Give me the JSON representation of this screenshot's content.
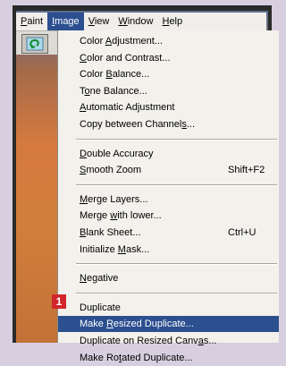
{
  "menubar": {
    "items": [
      {
        "label": "Paint",
        "u": 0
      },
      {
        "label": "Image",
        "u": 0
      },
      {
        "label": "View",
        "u": 0
      },
      {
        "label": "Window",
        "u": 0
      },
      {
        "label": "Help",
        "u": 0
      }
    ],
    "active_index": 1
  },
  "toolbar": {
    "icon": "rotate-arrow-icon"
  },
  "image_menu": {
    "groups": [
      [
        {
          "label": "Color Adjustment...",
          "u": 6
        },
        {
          "label": "Color and Contrast...",
          "u": 0
        },
        {
          "label": "Color Balance...",
          "u": 6
        },
        {
          "label": "Tone Balance...",
          "u": 1
        },
        {
          "label": "Automatic Adjustment",
          "u": 0
        },
        {
          "label": "Copy between Channels...",
          "u": 20
        }
      ],
      [
        {
          "label": "Double Accuracy",
          "u": 0
        },
        {
          "label": "Smooth Zoom",
          "u": 0,
          "shortcut": "Shift+F2"
        }
      ],
      [
        {
          "label": "Merge Layers...",
          "u": 0
        },
        {
          "label": "Merge with lower...",
          "u": 6
        },
        {
          "label": "Blank Sheet...",
          "u": 0,
          "shortcut": "Ctrl+U"
        },
        {
          "label": "Initialize Mask...",
          "u": 11
        }
      ],
      [
        {
          "label": "Negative",
          "u": 0
        }
      ],
      [
        {
          "label": "Duplicate",
          "u": -1
        },
        {
          "label": "Make Resized Duplicate...",
          "u": 5,
          "highlighted": true
        },
        {
          "label": "Duplicate on Resized Canvas...",
          "u": 25
        },
        {
          "label": "Make Rotated Duplicate...",
          "u": 7
        }
      ]
    ]
  },
  "callout": {
    "number": "1",
    "color": "#d1262b"
  },
  "colors": {
    "highlight": "#2c4f8f",
    "menu_bg": "#f3f1ec"
  }
}
